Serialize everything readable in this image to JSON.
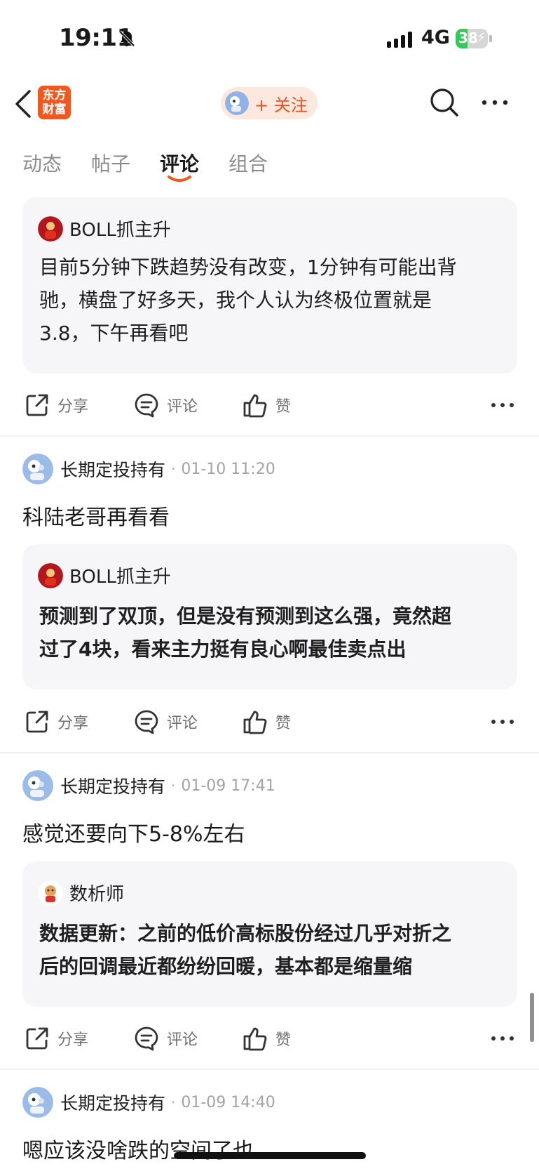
{
  "status_bar": {
    "time": "19:11",
    "network": "4G",
    "battery": "38",
    "battery_level": 0.38
  },
  "nav": {
    "logo_line1": "东方",
    "logo_line2": "财富",
    "follow_label": "+ 关注"
  },
  "tabs": [
    {
      "label": "动态"
    },
    {
      "label": "帖子"
    },
    {
      "label": "评论",
      "active": true
    },
    {
      "label": "组合"
    }
  ],
  "actions": {
    "share": "分享",
    "comment": "评论",
    "like": "赞"
  },
  "posts": [
    {
      "quote": {
        "author": "BOLL抓主升",
        "lines": [
          "目前5分钟下跌趋势没有改变，1分钟有可能出背",
          "驰，横盘了好多天，我个人认为终极位置就是",
          "3.8，下午再看吧"
        ]
      }
    },
    {
      "user": "长期定投持有",
      "time": "01-10 11:20",
      "text": "科陆老哥再看看",
      "quote": {
        "author": "BOLL抓主升",
        "lines": [
          "预测到了双顶，但是没有预测到这么强，竟然超",
          "过了4块，看来主力挺有良心啊最佳卖点出"
        ]
      }
    },
    {
      "user": "长期定投持有",
      "time": "01-09 17:41",
      "text": "感觉还要向下5-8%左右",
      "quote": {
        "author": "数析师",
        "lines": [
          "数据更新：之前的低价高标股份经过几乎对折之",
          "后的回调最近都纷纷回暖，基本都是缩量缩"
        ]
      }
    },
    {
      "user": "长期定投持有",
      "time": "01-09 14:40",
      "text": "嗯应该没啥跌的空间了也"
    }
  ]
}
